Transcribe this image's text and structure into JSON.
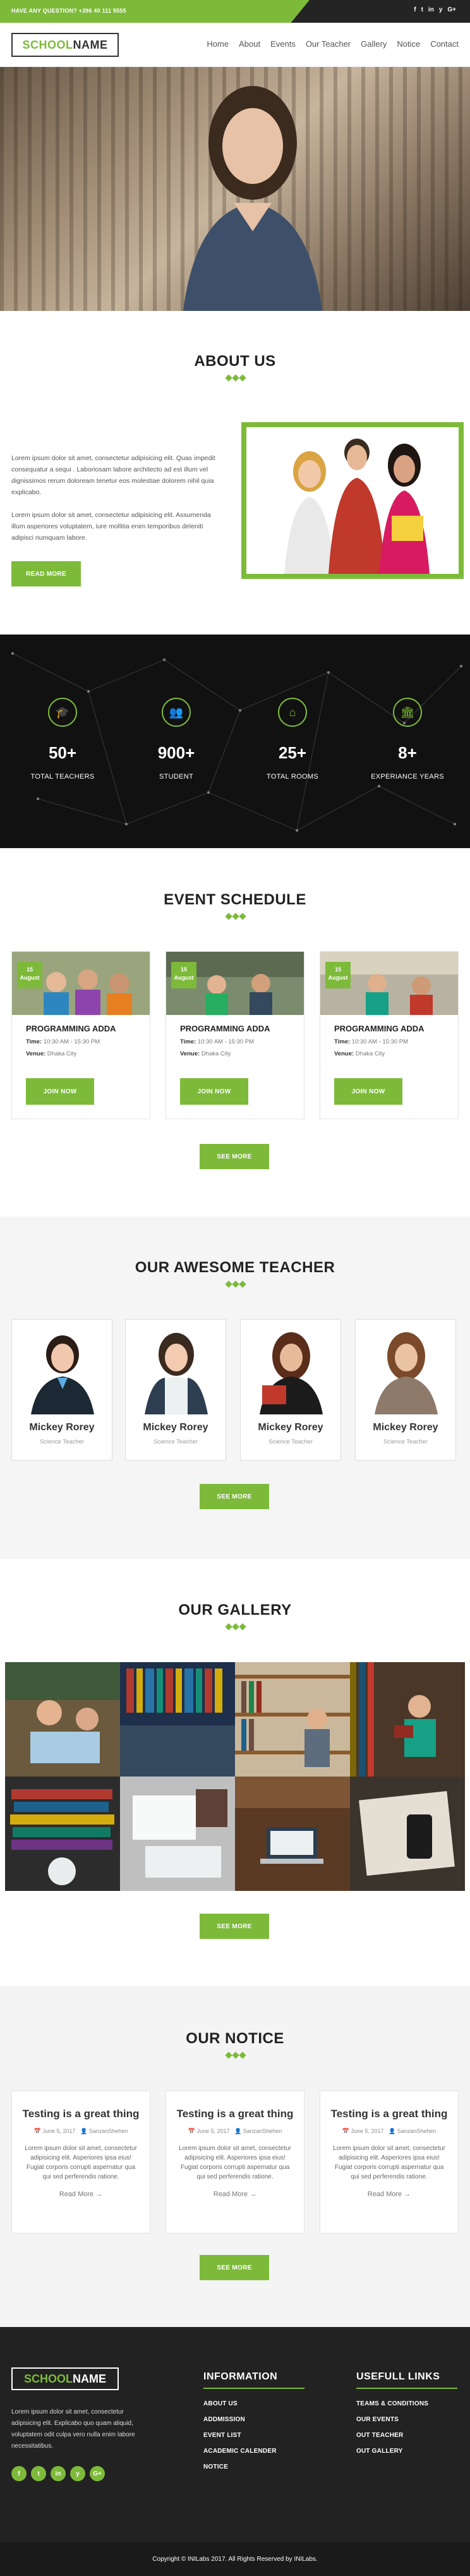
{
  "topbar": {
    "question": "HAVE ANY QUESTION? +396 40 111 5555",
    "social": [
      "f",
      "t",
      "in",
      "y",
      "G+"
    ]
  },
  "brand": {
    "part1": "SCHOOL",
    "part2": "NAME"
  },
  "nav": [
    "Home",
    "About",
    "Events",
    "Our Teacher",
    "Gallery",
    "Notice",
    "Contact"
  ],
  "about": {
    "title": "ABOUT US",
    "para1": "Lorem ipsum dolor sit amet, consectetur adipisicing elit. Quas impedit consequatur a sequi . Laboriosam labore architecto ad est illum vel dignissimos rerum doloream tenetur eos molestiae dolorem nihil quia explicabo.",
    "para2": "Lorem ipsum dolor sit amet, consectetur adipisicing elit. Assumenda illum asperiores voluptatem, iure mollitia enim temporibus deleniti adipisci numquam labore.",
    "button": "READ MORE"
  },
  "stats": [
    {
      "icon": "graduation-cap-icon",
      "glyph": "🎓",
      "number": "50+",
      "label": "TOTAL TEACHERS"
    },
    {
      "icon": "student-icon",
      "glyph": "👥",
      "number": "900+",
      "label": "STUDENT"
    },
    {
      "icon": "home-icon",
      "glyph": "⌂",
      "number": "25+",
      "label": "TOTAL ROOMS"
    },
    {
      "icon": "institution-icon",
      "glyph": "🏛",
      "number": "8+",
      "label": "EXPERIANCE YEARS"
    }
  ],
  "events": {
    "title": "EVENT SCHEDULE",
    "time_label": "Time:",
    "venue_label": "Venue:",
    "items": [
      {
        "day": "15",
        "month": "August",
        "title": "PROGRAMMING ADDA",
        "time": "10:30 AM - 15:30 PM",
        "venue": "Dhaka City",
        "button": "JOIN NOW"
      },
      {
        "day": "15",
        "month": "August",
        "title": "PROGRAMMING ADDA",
        "time": "10:30 AM - 15:30 PM",
        "venue": "Dhaka City",
        "button": "JOIN NOW"
      },
      {
        "day": "15",
        "month": "August",
        "title": "PROGRAMMING ADDA",
        "time": "10:30 AM - 15:30 PM",
        "venue": "Dhaka City",
        "button": "JOIN NOW"
      }
    ],
    "see_more": "SEE MORE"
  },
  "teachers": {
    "title": "OUR AWESOME TEACHER",
    "items": [
      {
        "name": "Mickey Rorey",
        "role": "Science Teacher"
      },
      {
        "name": "Mickey Rorey",
        "role": "Science Teacher"
      },
      {
        "name": "Mickey Rorey",
        "role": "Science Teacher"
      },
      {
        "name": "Mickey Rorey",
        "role": "Science Teacher"
      }
    ],
    "see_more": "SEE MORE"
  },
  "gallery": {
    "title": "OUR GALLERY",
    "see_more": "SEE MORE"
  },
  "notice": {
    "title": "OUR NOTICE",
    "items": [
      {
        "title": "Testing is a great thing",
        "date": "June 5, 2017",
        "author": "SanzanShehen",
        "desc": "Lorem ipsum dolor sit amet, consectetur adipisicing elit. Asperiores ipsa eius! Fugiat corporis corrupti aspernatur qua qui sed perferendis ratione.",
        "read_more": "Read More →"
      },
      {
        "title": "Testing is a great thing",
        "date": "June 5, 2017",
        "author": "SanzanShehen",
        "desc": "Lorem ipsum dolor sit amet, consectetur adipisicing elit. Asperiores ipsa eius! Fugiat corporis corrupti aspernatur qua qui sed perferendis ratione.",
        "read_more": "Read More →"
      },
      {
        "title": "Testing is a great thing",
        "date": "June 5, 2017",
        "author": "SanzanShehen",
        "desc": "Lorem ipsum dolor sit amet, consectetur adipisicing elit. Asperiores ipsa eius! Fugiat corporis corrupti aspernatur qua qui sed perferendis ratione.",
        "read_more": "Read More →"
      }
    ],
    "see_more": "SEE MORE"
  },
  "footer": {
    "about": "Lorem ipsum dolor sit amet, consectetur adipisicing elit. Explicabo quo quam aliquid, voluptatem odit culpa vero nulla enim labore necessitatibus.",
    "social": [
      "f",
      "t",
      "in",
      "y",
      "G+"
    ],
    "info_title": "INFORMATION",
    "info_links": [
      "ABOUT US",
      "ADDMISSION",
      "EVENT LIST",
      "ACADEMIC CALENDER",
      "NOTICE"
    ],
    "useful_title": "USEFULL LINKS",
    "useful_links": [
      "TEAMS & CONDITIONS",
      "OUR EVENTS",
      "OUT TEACHER",
      "OUT GALLERY"
    ],
    "copyright": "Copyright © INILabs 2017. All Rights Reserved by INILabs."
  },
  "colors": {
    "accent": "#7dba3a",
    "dark": "#222222"
  }
}
